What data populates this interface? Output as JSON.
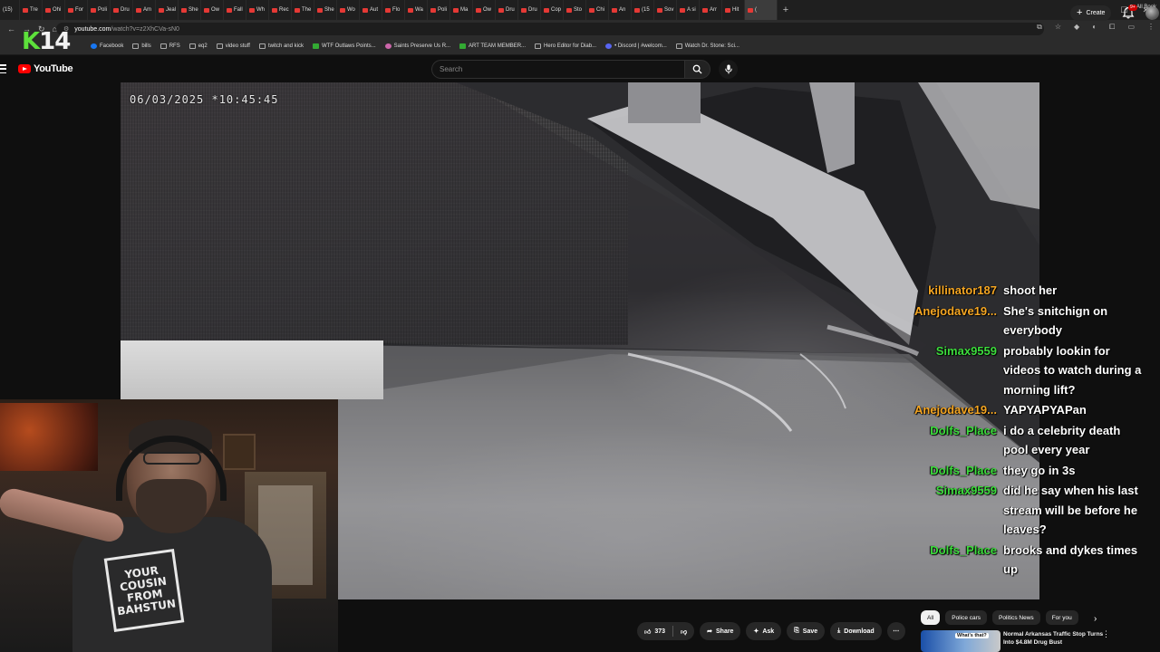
{
  "browser": {
    "tabs": [
      "(15)",
      "Tre",
      "Ohi",
      "For",
      "Poli",
      "Dru",
      "Am",
      "Jeal",
      "She",
      "Ow",
      "Fall",
      "Wh",
      "Rec",
      "The",
      "She",
      "Wo",
      "Aut",
      "Flo",
      "Wa",
      "Poli",
      "Ma",
      "Ow",
      "Dru",
      "Dru",
      "Cop",
      "Sto",
      "Chi",
      "An",
      "(15",
      "Sov",
      "A si",
      "Arr",
      "Hit",
      "("
    ],
    "url_host": "youtube.com",
    "url_path": "/watch?v=z2XhCVa-sN0",
    "bookmarks": [
      "Facebook",
      "bills",
      "RFS",
      "eq2",
      "video stuff",
      "twitch and kick",
      "WTF Outlaws Points...",
      "Saints Preserve Us R...",
      "ART TEAM MEMBER...",
      "Hero Editor for Diab...",
      "• Discord | #welcom...",
      "Watch Dr. Stone: Sci..."
    ],
    "bookmarks_right": "All Book"
  },
  "overlay": {
    "k": "K",
    "number": "14"
  },
  "header": {
    "logo_text": "YouTube",
    "search_placeholder": "Search",
    "create_label": "Create",
    "notification_badge": "9+"
  },
  "video": {
    "timestamp": "06/03/2025 *10:45:45"
  },
  "chat": {
    "messages": [
      {
        "user": "killinator187",
        "text": "shoot her",
        "color": "#f5a623"
      },
      {
        "user": "Anejodave19...",
        "text": "She's snitchign on everybody",
        "color": "#f5a623"
      },
      {
        "user": "Simax9559",
        "text": "probably lookin for videos to watch during a morning lift?",
        "color": "#3ddc3d"
      },
      {
        "user": "Anejodave19...",
        "text": "YAPYAPYAPan",
        "color": "#f5a623"
      },
      {
        "user": "Dolfs_Place",
        "text": "i do a celebrity death pool every year",
        "color": "#3ddc3d"
      },
      {
        "user": "Dolfs_Place",
        "text": "they go in 3s",
        "color": "#3ddc3d"
      },
      {
        "user": "Simax9559",
        "text": "did he say when his last stream will be before he leaves?",
        "color": "#3ddc3d"
      },
      {
        "user": "Dolfs_Place",
        "text": "brooks and dykes times up",
        "color": "#3ddc3d"
      }
    ]
  },
  "webcam": {
    "shirt_lines": [
      "YOUR",
      "COUSIN",
      "FROM",
      "BAHSTUN"
    ]
  },
  "actions": {
    "like_count": "373",
    "share_label": "Share",
    "ask_label": "Ask",
    "save_label": "Save",
    "download_label": "Download"
  },
  "chips": [
    "All",
    "Police cars",
    "Politics News",
    "For you"
  ],
  "recommended": {
    "title": "Normal Arkansas Traffic Stop Turns Into $4.8M Drug Bust",
    "thumb_badge": "What's that?"
  },
  "colors": {
    "brand_red": "#ff0000",
    "k_green": "#5de03b",
    "chat_orange": "#f5a623",
    "chat_green": "#3ddc3d"
  }
}
